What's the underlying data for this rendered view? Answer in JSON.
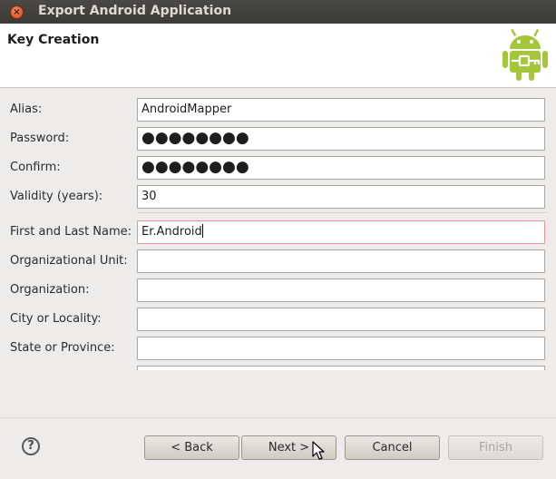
{
  "window": {
    "title": "Export Android Application"
  },
  "header": {
    "title": "Key Creation",
    "logo_icon": "android-robot-icon"
  },
  "form": {
    "alias": {
      "label": "Alias:",
      "value": "AndroidMapper"
    },
    "password": {
      "label": "Password:",
      "value": "●●●●●●●●"
    },
    "confirm": {
      "label": "Confirm:",
      "value": "●●●●●●●●"
    },
    "validity": {
      "label": "Validity (years):",
      "value": "30"
    },
    "name": {
      "label": "First and Last Name:",
      "value": "Er.Android"
    },
    "unit": {
      "label": "Organizational Unit:",
      "value": ""
    },
    "organization": {
      "label": "Organization:",
      "value": ""
    },
    "city": {
      "label": "City or Locality:",
      "value": ""
    },
    "state": {
      "label": "State or Province:",
      "value": ""
    }
  },
  "buttons": {
    "back": "< Back",
    "next": "Next >",
    "cancel": "Cancel",
    "finish": "Finish",
    "help": "?"
  },
  "colors": {
    "android_green": "#a4c639",
    "focus_border": "#e8968f"
  }
}
